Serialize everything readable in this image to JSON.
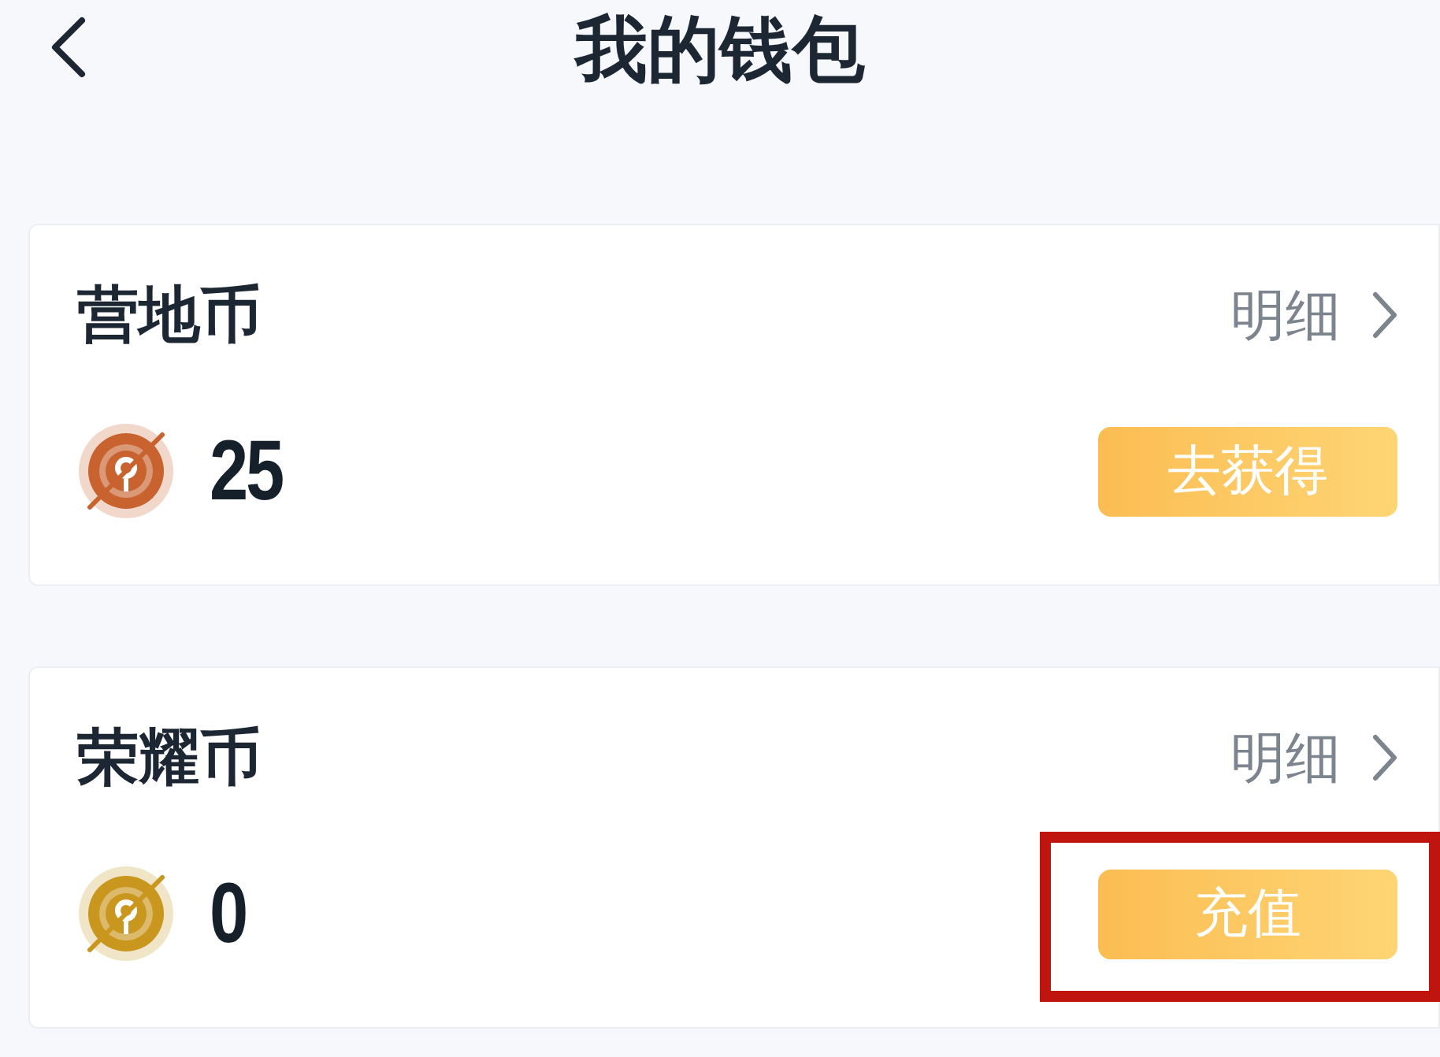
{
  "header": {
    "title": "我的钱包"
  },
  "wallets": [
    {
      "name": "营地币",
      "details_link": "明细",
      "color": "#c8622f",
      "balance": "25",
      "action": {
        "label": "去获得",
        "highlighted": false
      }
    },
    {
      "name": "荣耀币",
      "details_link": "明细",
      "color": "#c9961e",
      "balance": "0",
      "action": {
        "label": "充值",
        "highlighted": true
      }
    }
  ]
}
